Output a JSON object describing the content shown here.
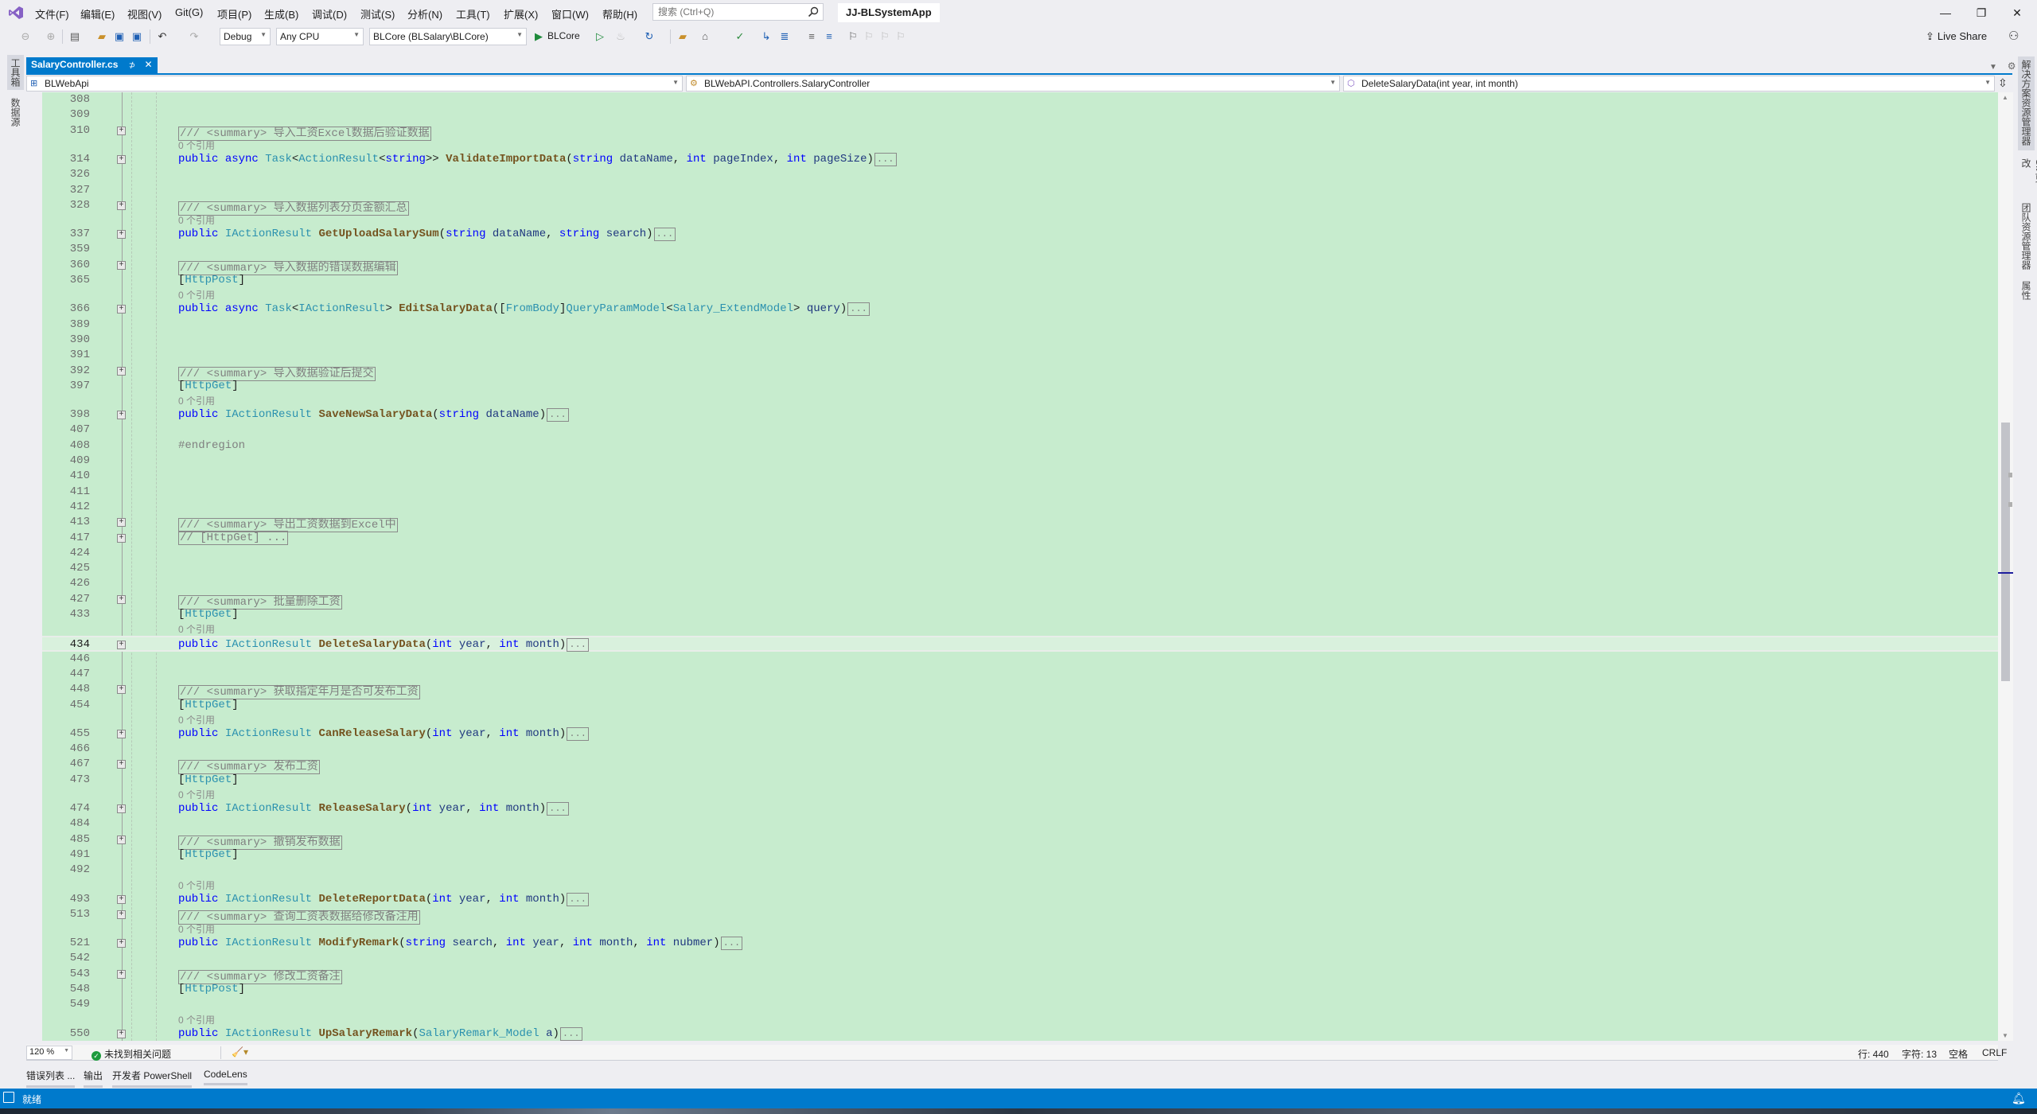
{
  "menubar": {
    "items": [
      "文件(F)",
      "编辑(E)",
      "视图(V)",
      "Git(G)",
      "项目(P)",
      "生成(B)",
      "调试(D)",
      "测试(S)",
      "分析(N)",
      "工具(T)",
      "扩展(X)",
      "窗口(W)",
      "帮助(H)"
    ],
    "search_placeholder": "搜索 (Ctrl+Q)",
    "solution_name": "JJ-BLSystemApp",
    "window_buttons": {
      "minimize": "—",
      "restore": "❐",
      "close": "✕"
    }
  },
  "toolbar": {
    "configuration": "Debug",
    "platform": "Any CPU",
    "startup_project": "BLCore (BLSalary\\BLCore)",
    "run_target": "BLCore",
    "live_share": "Live Share"
  },
  "left_strip": {
    "tabs": [
      "工具箱",
      "数据源"
    ]
  },
  "right_strip": {
    "tabs": [
      "解决方案资源管理器",
      "Git 更改",
      "团队资源管理器",
      "属性"
    ]
  },
  "document_tab": {
    "title": "SalaryController.cs",
    "pin": "⊅",
    "close": "✕"
  },
  "navbar": {
    "project": "BLWebApi",
    "type": "BLWebAPI.Controllers.SalaryController",
    "member": "DeleteSalaryData(int year, int month)"
  },
  "editor": {
    "current_line": "434",
    "rows": [
      {
        "ln": "308",
        "kind": "blank"
      },
      {
        "ln": "309",
        "kind": "blank"
      },
      {
        "ln": "310",
        "kind": "summary",
        "fold": true,
        "text": "/// <summary> 导入工资Excel数据后验证数据"
      },
      {
        "kind": "lens",
        "text": "0 个引用"
      },
      {
        "ln": "314",
        "kind": "sig",
        "fold": true,
        "tokens": [
          [
            "kw",
            "public "
          ],
          [
            "kw",
            "async "
          ],
          [
            "ty",
            "Task"
          ],
          [
            "",
            "<"
          ],
          [
            "ty",
            "ActionResult"
          ],
          [
            "",
            "<"
          ],
          [
            "kw",
            "string"
          ],
          [
            "",
            ">> "
          ],
          [
            "fn",
            "ValidateImportData"
          ],
          [
            "",
            "("
          ],
          [
            "kw",
            "string "
          ],
          [
            "pr",
            "dataName"
          ],
          [
            "",
            ", "
          ],
          [
            "kw",
            "int "
          ],
          [
            "pr",
            "pageIndex"
          ],
          [
            "",
            ", "
          ],
          [
            "kw",
            "int "
          ],
          [
            "pr",
            "pageSize"
          ],
          [
            "",
            ")"
          ]
        ]
      },
      {
        "ln": "326",
        "kind": "blank"
      },
      {
        "ln": "327",
        "kind": "blank"
      },
      {
        "ln": "328",
        "kind": "summary",
        "fold": true,
        "text": "/// <summary> 导入数据列表分页金额汇总"
      },
      {
        "kind": "lens",
        "text": "0 个引用"
      },
      {
        "ln": "337",
        "kind": "sig",
        "fold": true,
        "tokens": [
          [
            "kw",
            "public "
          ],
          [
            "ty",
            "IActionResult "
          ],
          [
            "fn",
            "GetUploadSalarySum"
          ],
          [
            "",
            "("
          ],
          [
            "kw",
            "string "
          ],
          [
            "pr",
            "dataName"
          ],
          [
            "",
            ", "
          ],
          [
            "kw",
            "string "
          ],
          [
            "pr",
            "search"
          ],
          [
            "",
            ")"
          ]
        ]
      },
      {
        "ln": "359",
        "kind": "blank"
      },
      {
        "ln": "360",
        "kind": "summary",
        "fold": true,
        "text": "/// <summary> 导入数据的错误数据编辑"
      },
      {
        "ln": "365",
        "kind": "attr",
        "text": "HttpPost"
      },
      {
        "kind": "lens",
        "text": "0 个引用"
      },
      {
        "ln": "366",
        "kind": "sig",
        "fold": true,
        "tokens": [
          [
            "kw",
            "public "
          ],
          [
            "kw",
            "async "
          ],
          [
            "ty",
            "Task"
          ],
          [
            "",
            "<"
          ],
          [
            "ty",
            "IActionResult"
          ],
          [
            "",
            "> "
          ],
          [
            "fn",
            "EditSalaryData"
          ],
          [
            "",
            "(["
          ],
          [
            "ty",
            "FromBody"
          ],
          [
            "",
            "]"
          ],
          [
            "ty",
            "QueryParamModel"
          ],
          [
            "",
            "<"
          ],
          [
            "ty",
            "Salary_ExtendModel"
          ],
          [
            "",
            "> "
          ],
          [
            "pr",
            "query"
          ],
          [
            "",
            ")"
          ]
        ]
      },
      {
        "ln": "389",
        "kind": "blank"
      },
      {
        "ln": "390",
        "kind": "blank"
      },
      {
        "ln": "391",
        "kind": "blank"
      },
      {
        "ln": "392",
        "kind": "summary",
        "fold": true,
        "text": "/// <summary> 导入数据验证后提交"
      },
      {
        "ln": "397",
        "kind": "attr",
        "text": "HttpGet"
      },
      {
        "kind": "lens",
        "text": "0 个引用"
      },
      {
        "ln": "398",
        "kind": "sig",
        "fold": true,
        "tokens": [
          [
            "kw",
            "public "
          ],
          [
            "ty",
            "IActionResult "
          ],
          [
            "fn",
            "SaveNewSalaryData"
          ],
          [
            "",
            "("
          ],
          [
            "kw",
            "string "
          ],
          [
            "pr",
            "dataName"
          ],
          [
            "",
            ")"
          ]
        ]
      },
      {
        "ln": "407",
        "kind": "blank"
      },
      {
        "ln": "408",
        "kind": "directive",
        "text": "#endregion"
      },
      {
        "ln": "409",
        "kind": "blank"
      },
      {
        "ln": "410",
        "kind": "blank"
      },
      {
        "ln": "411",
        "kind": "blank"
      },
      {
        "ln": "412",
        "kind": "blank"
      },
      {
        "ln": "413",
        "kind": "summary",
        "fold": true,
        "text": "/// <summary> 导出工资数据到Excel中"
      },
      {
        "ln": "417",
        "kind": "summary",
        "fold": true,
        "text": "// [HttpGet] ..."
      },
      {
        "ln": "424",
        "kind": "blank"
      },
      {
        "ln": "425",
        "kind": "blank"
      },
      {
        "ln": "426",
        "kind": "blank"
      },
      {
        "ln": "427",
        "kind": "summary",
        "fold": true,
        "text": "/// <summary> 批量删除工资"
      },
      {
        "ln": "433",
        "kind": "attr",
        "text": "HttpGet"
      },
      {
        "kind": "lens",
        "text": "0 个引用"
      },
      {
        "ln": "434",
        "kind": "sig",
        "fold": true,
        "current": true,
        "tokens": [
          [
            "kw",
            "public "
          ],
          [
            "ty",
            "IActionResult "
          ],
          [
            "fn",
            "DeleteSalaryData"
          ],
          [
            "",
            "("
          ],
          [
            "kw",
            "int "
          ],
          [
            "pr",
            "year"
          ],
          [
            "",
            ", "
          ],
          [
            "kw",
            "int "
          ],
          [
            "pr",
            "month"
          ],
          [
            "",
            ")"
          ]
        ]
      },
      {
        "ln": "446",
        "kind": "blank"
      },
      {
        "ln": "447",
        "kind": "blank"
      },
      {
        "ln": "448",
        "kind": "summary",
        "fold": true,
        "text": "/// <summary> 获取指定年月是否可发布工资"
      },
      {
        "ln": "454",
        "kind": "attr",
        "text": "HttpGet"
      },
      {
        "kind": "lens",
        "text": "0 个引用"
      },
      {
        "ln": "455",
        "kind": "sig",
        "fold": true,
        "tokens": [
          [
            "kw",
            "public "
          ],
          [
            "ty",
            "IActionResult "
          ],
          [
            "fn",
            "CanReleaseSalary"
          ],
          [
            "",
            "("
          ],
          [
            "kw",
            "int "
          ],
          [
            "pr",
            "year"
          ],
          [
            "",
            ", "
          ],
          [
            "kw",
            "int "
          ],
          [
            "pr",
            "month"
          ],
          [
            "",
            ")"
          ]
        ]
      },
      {
        "ln": "466",
        "kind": "blank"
      },
      {
        "ln": "467",
        "kind": "summary",
        "fold": true,
        "text": "/// <summary> 发布工资"
      },
      {
        "ln": "473",
        "kind": "attr",
        "text": "HttpGet"
      },
      {
        "kind": "lens",
        "text": "0 个引用"
      },
      {
        "ln": "474",
        "kind": "sig",
        "fold": true,
        "tokens": [
          [
            "kw",
            "public "
          ],
          [
            "ty",
            "IActionResult "
          ],
          [
            "fn",
            "ReleaseSalary"
          ],
          [
            "",
            "("
          ],
          [
            "kw",
            "int "
          ],
          [
            "pr",
            "year"
          ],
          [
            "",
            ", "
          ],
          [
            "kw",
            "int "
          ],
          [
            "pr",
            "month"
          ],
          [
            "",
            ")"
          ]
        ]
      },
      {
        "ln": "484",
        "kind": "blank"
      },
      {
        "ln": "485",
        "kind": "summary",
        "fold": true,
        "text": "/// <summary> 撤销发布数据"
      },
      {
        "ln": "491",
        "kind": "attr",
        "text": "HttpGet"
      },
      {
        "ln": "492",
        "kind": "blank"
      },
      {
        "kind": "lens",
        "text": "0 个引用"
      },
      {
        "ln": "493",
        "kind": "sig",
        "fold": true,
        "tokens": [
          [
            "kw",
            "public "
          ],
          [
            "ty",
            "IActionResult "
          ],
          [
            "fn",
            "DeleteReportData"
          ],
          [
            "",
            "("
          ],
          [
            "kw",
            "int "
          ],
          [
            "pr",
            "year"
          ],
          [
            "",
            ", "
          ],
          [
            "kw",
            "int "
          ],
          [
            "pr",
            "month"
          ],
          [
            "",
            ")"
          ]
        ]
      },
      {
        "ln": "513",
        "kind": "summary",
        "fold": true,
        "text": "/// <summary> 查询工资表数据给修改备注用"
      },
      {
        "kind": "lens",
        "text": "0 个引用"
      },
      {
        "ln": "521",
        "kind": "sig",
        "fold": true,
        "tokens": [
          [
            "kw",
            "public "
          ],
          [
            "ty",
            "IActionResult "
          ],
          [
            "fn",
            "ModifyRemark"
          ],
          [
            "",
            "("
          ],
          [
            "kw",
            "string "
          ],
          [
            "pr",
            "search"
          ],
          [
            "",
            ", "
          ],
          [
            "kw",
            "int "
          ],
          [
            "pr",
            "year"
          ],
          [
            "",
            ", "
          ],
          [
            "kw",
            "int "
          ],
          [
            "pr",
            "month"
          ],
          [
            "",
            ", "
          ],
          [
            "kw",
            "int "
          ],
          [
            "pr",
            "nubmer"
          ],
          [
            "",
            ")"
          ]
        ]
      },
      {
        "ln": "542",
        "kind": "blank"
      },
      {
        "ln": "543",
        "kind": "summary",
        "fold": true,
        "text": "/// <summary> 修改工资备注"
      },
      {
        "ln": "548",
        "kind": "attr",
        "text": "HttpPost"
      },
      {
        "ln": "549",
        "kind": "blank"
      },
      {
        "kind": "lens",
        "text": "0 个引用"
      },
      {
        "ln": "550",
        "kind": "sig",
        "fold": true,
        "tokens": [
          [
            "kw",
            "public "
          ],
          [
            "ty",
            "IActionResult "
          ],
          [
            "fn",
            "UpSalaryRemark"
          ],
          [
            "",
            "("
          ],
          [
            "ty",
            "SalaryRemark_Model "
          ],
          [
            "pr",
            "a"
          ],
          [
            "",
            ")"
          ]
        ]
      }
    ],
    "ellipsis": "..."
  },
  "editor_status": {
    "zoom": "120 %",
    "issues": "未找到相关问题",
    "line": "行: 440",
    "char": "字符: 13",
    "indent": "空格",
    "eol": "CRLF"
  },
  "bottom_tabs": [
    "错误列表 ...",
    "输出",
    "开发者 PowerShell",
    "CodeLens"
  ],
  "statusbar": {
    "message": "就绪"
  },
  "colors": {
    "accent": "#007acc",
    "editor_bg": "#c7ecce",
    "keyword": "#0000ff",
    "type": "#2b91af",
    "method": "#74531f",
    "comment": "#808080"
  }
}
